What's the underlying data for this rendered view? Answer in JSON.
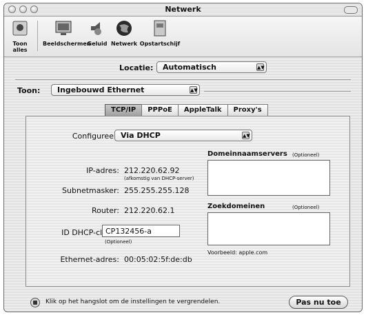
{
  "window": {
    "title": "Netwerk"
  },
  "toolbar": {
    "show_all": "Toon alles",
    "items": [
      {
        "label": "Beeldschermen",
        "icon": "display-icon"
      },
      {
        "label": "Geluid",
        "icon": "speaker-icon"
      },
      {
        "label": "Netwerk",
        "icon": "globe-icon"
      },
      {
        "label": "Opstartschijf",
        "icon": "disk-icon"
      }
    ]
  },
  "location": {
    "label": "Locatie:",
    "value": "Automatisch"
  },
  "show": {
    "label": "Toon:",
    "value": "Ingebouwd Ethernet"
  },
  "tabs": [
    {
      "label": "TCP/IP",
      "active": true
    },
    {
      "label": "PPPoE",
      "active": false
    },
    {
      "label": "AppleTalk",
      "active": false
    },
    {
      "label": "Proxy's",
      "active": false
    }
  ],
  "tcpip": {
    "configure_label": "Configureer:",
    "configure_value": "Via DHCP",
    "ip_label": "IP-adres:",
    "ip_value": "212.220.62.92",
    "ip_note": "(afkomstig van DHCP-server)",
    "subnet_label": "Subnetmasker:",
    "subnet_value": "255.255.255.128",
    "router_label": "Router:",
    "router_value": "212.220.62.1",
    "dhcp_label": "ID DHCP-client:",
    "dhcp_value": "CP132456-a",
    "dhcp_note": "(Optioneel)",
    "ethernet_label": "Ethernet-adres:",
    "ethernet_value": "00:05:02:5f:de:db",
    "dns_label": "Domeinnaamservers",
    "dns_optional": "(Optioneel)",
    "search_label": "Zoekdomeinen",
    "search_optional": "(Optioneel)",
    "search_example": "Voorbeeld: apple.com"
  },
  "footer": {
    "lock_text": "Klik op het hangslot om de instellingen te vergrendelen.",
    "apply_button": "Pas nu toe"
  }
}
